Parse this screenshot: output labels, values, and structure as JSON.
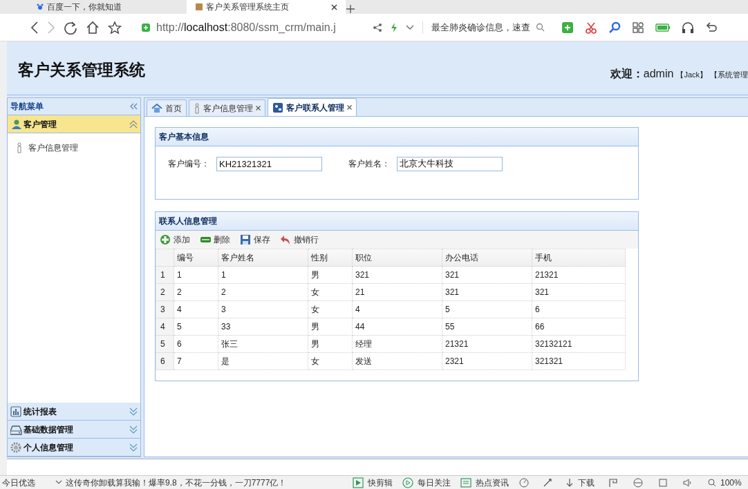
{
  "browser": {
    "tabs": [
      {
        "label": "百度一下，你就知道",
        "selected": false
      },
      {
        "label": "客户关系管理系统主页",
        "selected": true
      }
    ],
    "url_scheme": "http://",
    "url_host": "localhost",
    "url_rest": ":8080/ssm_crm/main.j",
    "search_placeholder": "最全肺炎确诊信息，速查"
  },
  "header": {
    "title": "客户关系管理系统",
    "welcome_label": "欢迎：",
    "user": "admin",
    "role_1": "【Jack】",
    "role_2": "【系统管理"
  },
  "sidebar": {
    "title": "导航菜单",
    "sections": [
      {
        "kind": "customer",
        "label": "客户管理",
        "expanded": true,
        "items": [
          {
            "label": "客户信息管理"
          }
        ]
      },
      {
        "kind": "chart",
        "label": "统计报表",
        "expanded": false
      },
      {
        "kind": "drive",
        "label": "基础数据管理",
        "expanded": false
      },
      {
        "kind": "gear",
        "label": "个人信息管理",
        "expanded": false
      }
    ]
  },
  "tabs": [
    {
      "kind": "home",
      "label": "首页",
      "closable": false,
      "selected": false
    },
    {
      "kind": "person",
      "label": "客户信息管理",
      "closable": true,
      "selected": false
    },
    {
      "kind": "contacts",
      "label": "客户联系人管理",
      "closable": true,
      "selected": true
    }
  ],
  "basic_info": {
    "title": "客户基本信息",
    "fields": [
      {
        "label": "客户编号：",
        "value": "KH21321321"
      },
      {
        "label": "客户姓名：",
        "value": "北京大牛科技"
      }
    ]
  },
  "contacts": {
    "title": "联系人信息管理",
    "toolbar": [
      {
        "kind": "add",
        "label": "添加"
      },
      {
        "kind": "remove",
        "label": "删除"
      },
      {
        "kind": "save",
        "label": "保存"
      },
      {
        "kind": "undo",
        "label": "撤销行"
      }
    ],
    "columns": [
      "编号",
      "客户姓名",
      "性别",
      "职位",
      "办公电话",
      "手机"
    ],
    "rows": [
      {
        "index": "1",
        "cells": [
          "1",
          "1",
          "男",
          "321",
          "321",
          "21321"
        ]
      },
      {
        "index": "2",
        "cells": [
          "2",
          "2",
          "女",
          "21",
          "321",
          "321"
        ]
      },
      {
        "index": "3",
        "cells": [
          "4",
          "3",
          "女",
          "4",
          "5",
          "6"
        ]
      },
      {
        "index": "4",
        "cells": [
          "5",
          "33",
          "男",
          "44",
          "55",
          "66"
        ]
      },
      {
        "index": "5",
        "cells": [
          "6",
          "张三",
          "男",
          "经理",
          "21321",
          "32132121"
        ]
      },
      {
        "index": "6",
        "cells": [
          "7",
          "是",
          "女",
          "发送",
          "2321",
          "321321"
        ]
      }
    ]
  },
  "status_bar": {
    "left": "今日优选",
    "news": "这传奇你卸载算我输！爆率9.8，不花一分钱，一刀7777亿！",
    "items": [
      {
        "kind": "play-box",
        "label": "快剪辑"
      },
      {
        "kind": "play-circle",
        "label": "每日关注"
      },
      {
        "kind": "news",
        "label": "热点资讯"
      }
    ],
    "download": "下载",
    "zoom": "100%"
  }
}
